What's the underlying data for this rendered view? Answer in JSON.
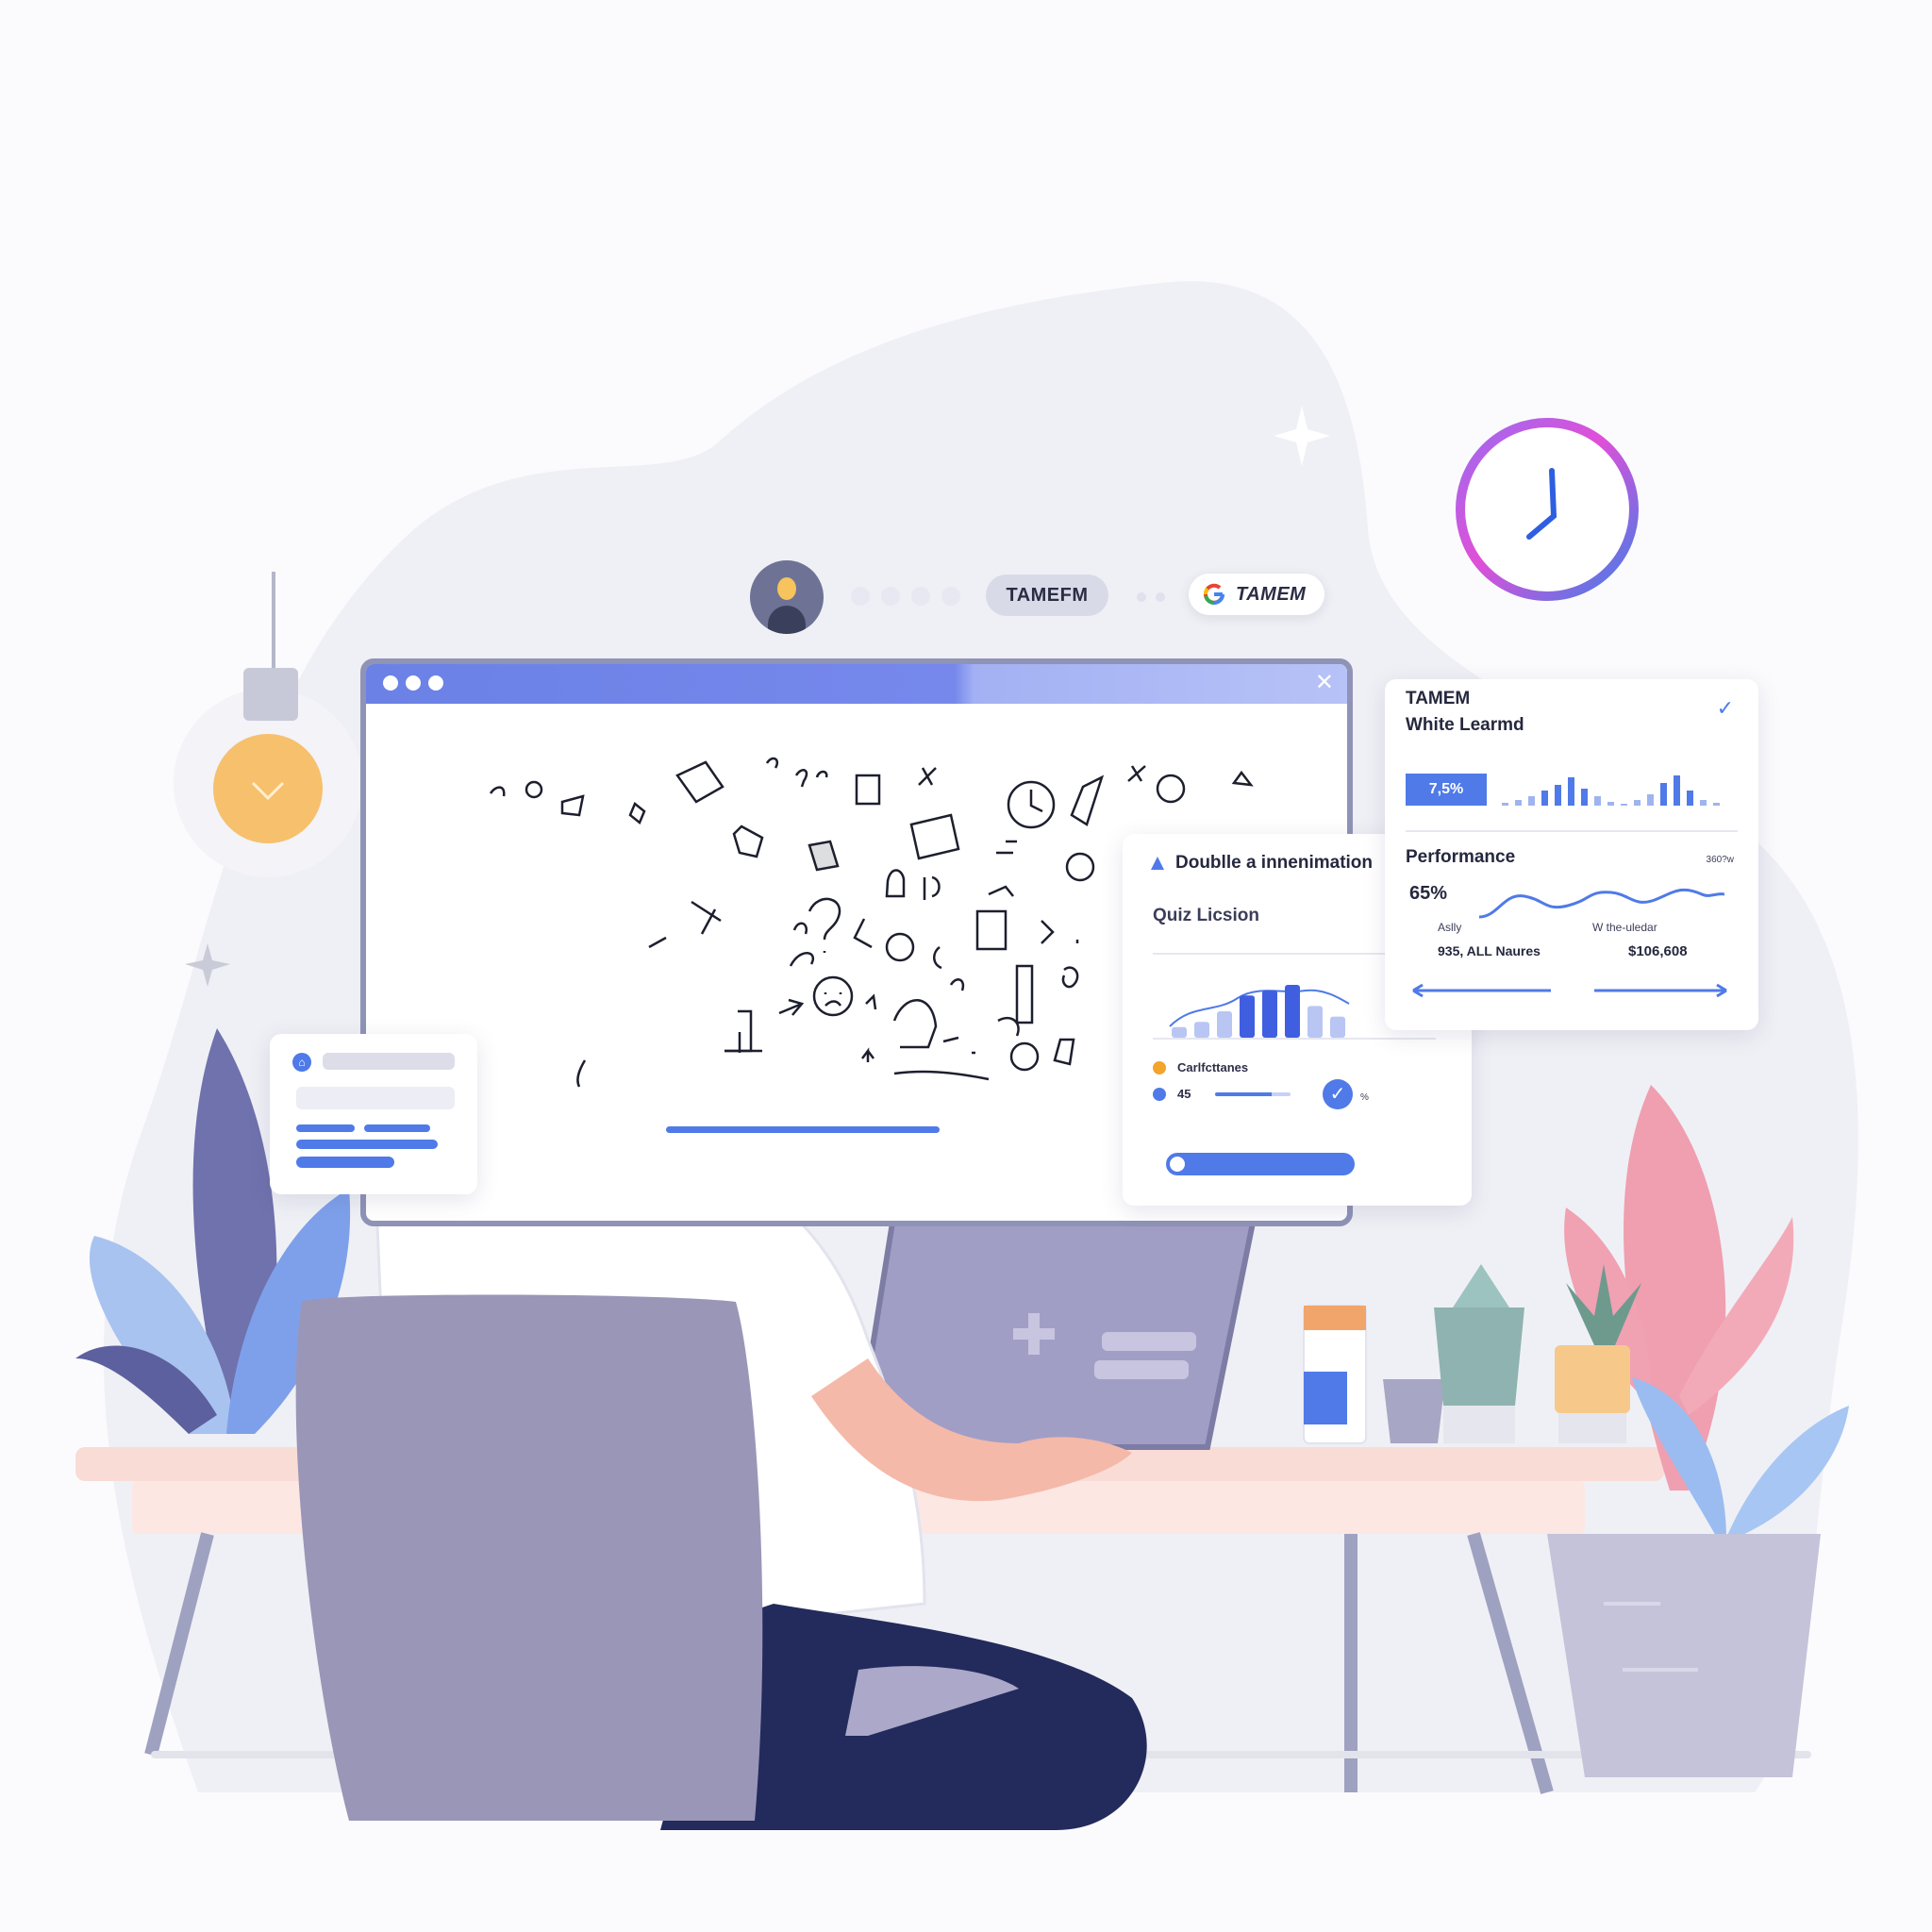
{
  "top_bar": {
    "pill_1_label": "TAMEFM",
    "pill_2_label": "TAMEM"
  },
  "quiz_card": {
    "title": "Doublle a innenimation",
    "subtitle": "Quiz Licsion",
    "legend_1_label": "Carlfcttanes",
    "legend_2_value": "45",
    "check_suffix": "%",
    "bar_values": [
      2,
      3,
      5,
      8,
      9,
      10,
      6,
      4
    ]
  },
  "performance_card": {
    "title_line_1": "TAMEM",
    "title_line_2": "White Learmd",
    "badge_value": "7,5%",
    "section_title": "Performance",
    "section_meta": "360?w",
    "main_value": "65%",
    "left_label": "Aslly",
    "left_value": "935, ALL Naures",
    "right_label": "W the-uledar",
    "right_value": "$106,608"
  },
  "colors": {
    "accent_blue": "#4f7ae8",
    "window_bar": "#6b81e6",
    "chair": "#9a96b8",
    "desk": "#f7dcd8",
    "clock_ring_start": "#9b6cf0",
    "clock_ring_end": "#e04fd8"
  },
  "icons": {
    "avatar": "lightbulb-avatar-icon",
    "clock": "clock-icon",
    "google": "google-g-icon",
    "check": "checkmark-icon"
  }
}
